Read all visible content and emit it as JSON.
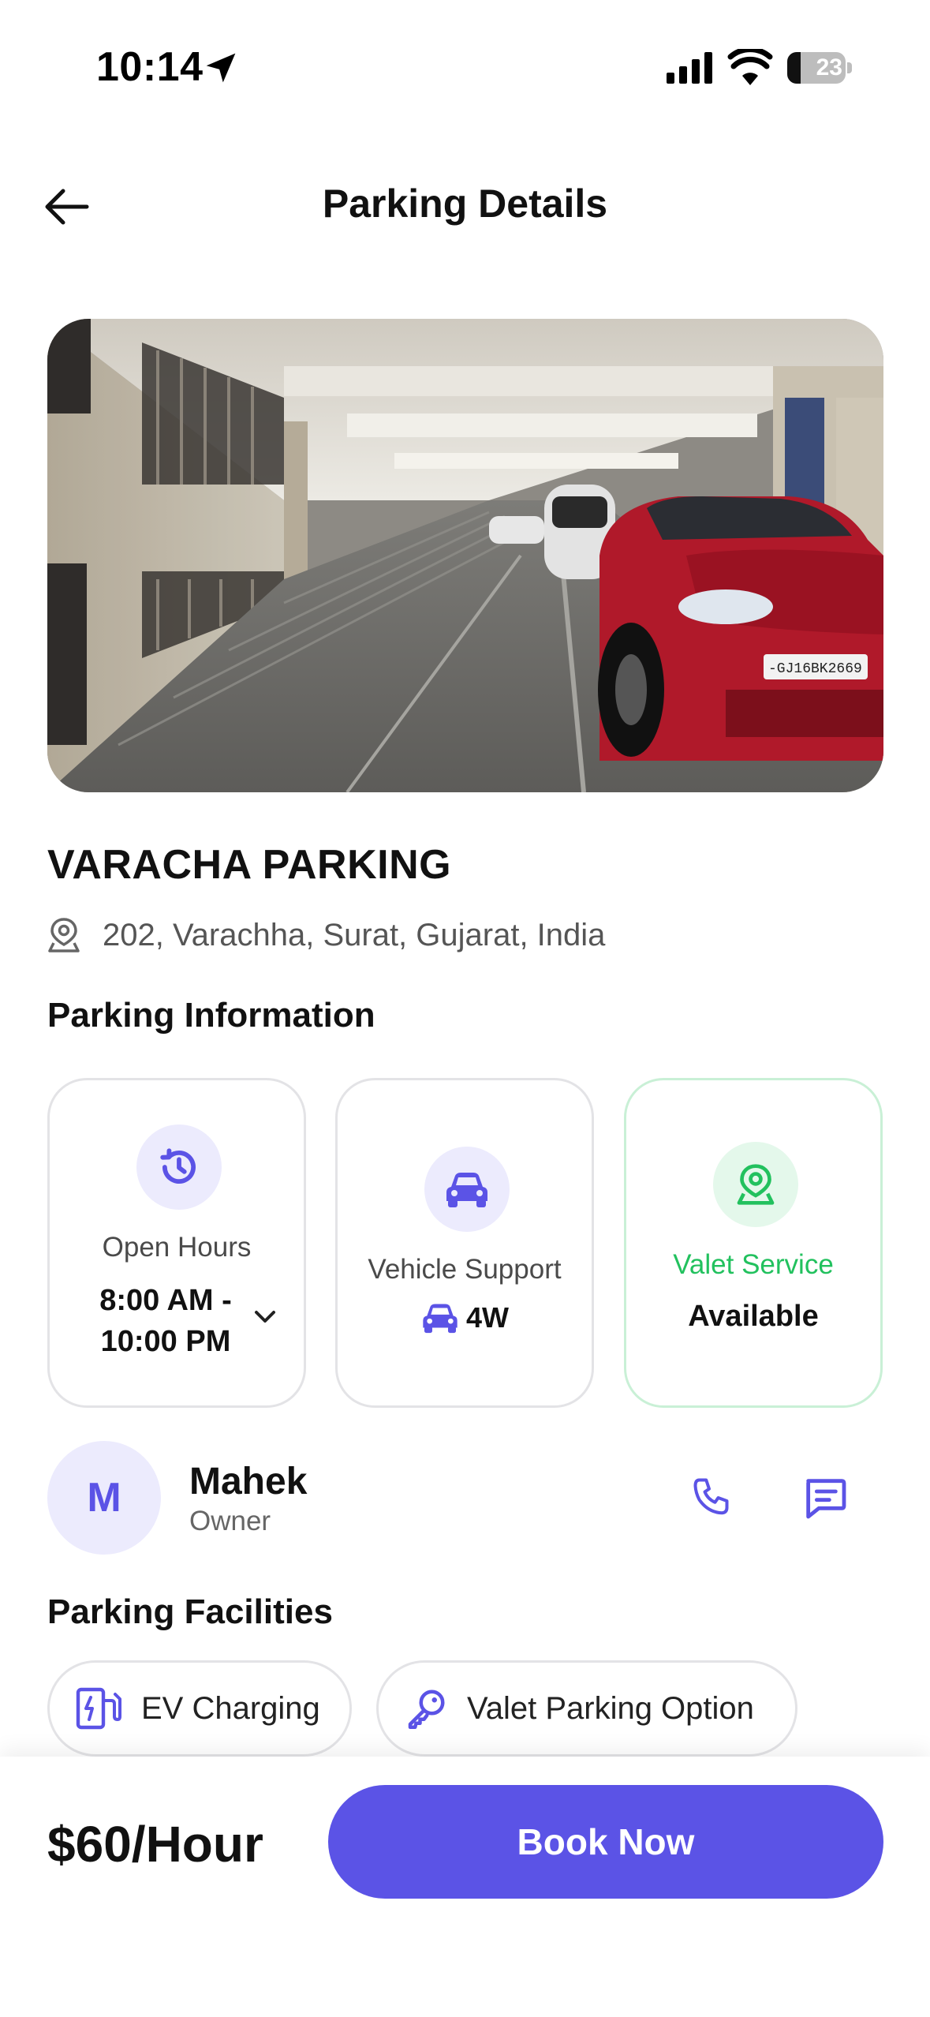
{
  "status_bar": {
    "time": "10:14",
    "battery": "23",
    "battery_level": 0.23,
    "icons": [
      "location-arrow-icon",
      "cellular-signal-icon",
      "wifi-icon",
      "battery-icon"
    ]
  },
  "header": {
    "title": "Parking Details",
    "back_icon": "arrow-left-icon"
  },
  "parking": {
    "name": "VARACHA PARKING",
    "address": "202, Varachha, Surat, Gujarat, India",
    "address_icon": "location-pin-icon",
    "photo": "parking-garage-photo"
  },
  "info": {
    "section_title": "Parking Information",
    "cards": [
      {
        "label": "Open Hours",
        "value_line1": "8:00 AM -",
        "value_line2": "10:00 PM",
        "icon": "clock-history-icon",
        "expand_icon": "chevron-down-icon"
      },
      {
        "label": "Vehicle Support",
        "value": "4W",
        "icon": "car-icon"
      },
      {
        "label": "Valet Service",
        "value": "Available",
        "icon": "location-pin-icon"
      }
    ]
  },
  "owner": {
    "initial": "M",
    "name": "Mahek",
    "role": "Owner",
    "actions": [
      "phone-icon",
      "message-icon"
    ]
  },
  "facilities": {
    "section_title": "Parking Facilities",
    "items": [
      {
        "label": "EV Charging",
        "icon": "ev-charging-icon"
      },
      {
        "label": "Valet Parking Option",
        "icon": "key-icon"
      }
    ]
  },
  "footer": {
    "price": "$60/Hour",
    "book_label": "Book Now"
  },
  "colors": {
    "accent": "#5B53E6",
    "accent_light": "#ECEBFD",
    "green": "#22C15E",
    "green_light": "#E4F8EB"
  }
}
